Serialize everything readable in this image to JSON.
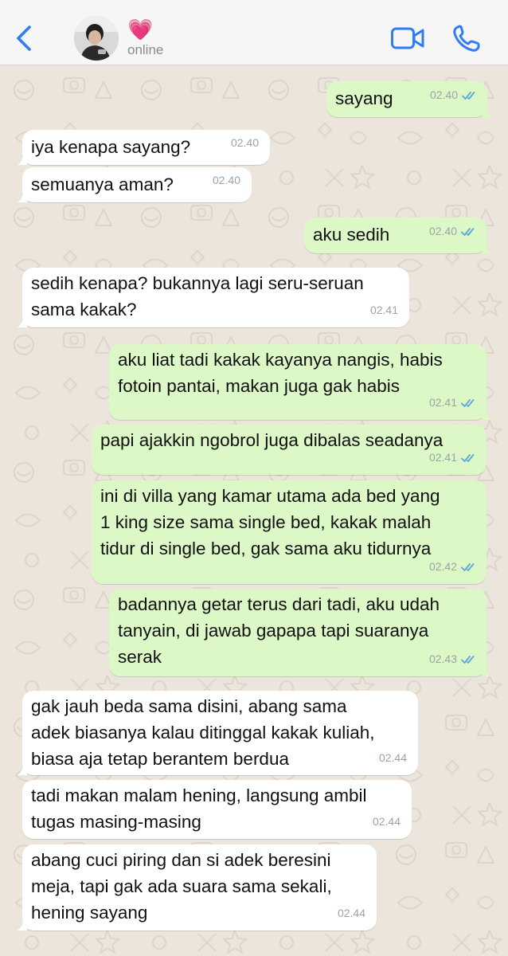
{
  "header": {
    "contact_name": "💗",
    "status": "online"
  },
  "colors": {
    "incoming_bubble": "#ffffff",
    "outgoing_bubble": "#dcf8c6",
    "accent_blue": "#2f7cf6",
    "read_ticks": "#5aa7d8",
    "timestamp": "#9aa3a6"
  },
  "icons": {
    "back": "chevron-left-icon",
    "video": "video-camera-icon",
    "call": "phone-icon",
    "read": "double-check-icon"
  },
  "messages": [
    {
      "dir": "out",
      "text": "sayang",
      "time": "02.40",
      "read": true
    },
    {
      "dir": "in",
      "text": "iya kenapa sayang?",
      "time": "02.40"
    },
    {
      "dir": "in",
      "text": "semuanya aman?",
      "time": "02.40"
    },
    {
      "dir": "out",
      "text": "aku sedih",
      "time": "02.40",
      "read": true
    },
    {
      "dir": "in",
      "text": "sedih kenapa? bukannya lagi seru-seruan\nsama kakak?",
      "time": "02.41"
    },
    {
      "dir": "out",
      "text": "aku liat tadi kakak kayanya nangis, habis\nfotoin pantai, makan juga gak habis",
      "time": "02.41",
      "read": true
    },
    {
      "dir": "out",
      "text": "papi ajakkin ngobrol juga dibalas seadanya",
      "time": "02.41",
      "read": true
    },
    {
      "dir": "out",
      "text": "ini di villa yang kamar utama ada bed yang\n1 king size sama single bed, kakak malah\ntidur di single bed, gak sama aku tidurnya",
      "time": "02.42",
      "read": true
    },
    {
      "dir": "out",
      "text": "badannya getar terus dari tadi, aku udah\ntanyain, di jawab gapapa tapi suaranya\nserak",
      "time": "02.43",
      "read": true
    },
    {
      "dir": "in",
      "text": "gak jauh beda sama disini, abang sama\nadek biasanya kalau ditinggal kakak kuliah,\nbiasa aja tetap berantem berdua",
      "time": "02.44"
    },
    {
      "dir": "in",
      "text": "tadi makan malam hening, langsung ambil\ntugas masing-masing",
      "time": "02.44"
    },
    {
      "dir": "in",
      "text": "abang cuci piring dan si adek beresini\nmeja, tapi gak ada suara sama sekali,\nhening sayang",
      "time": "02.44"
    }
  ]
}
